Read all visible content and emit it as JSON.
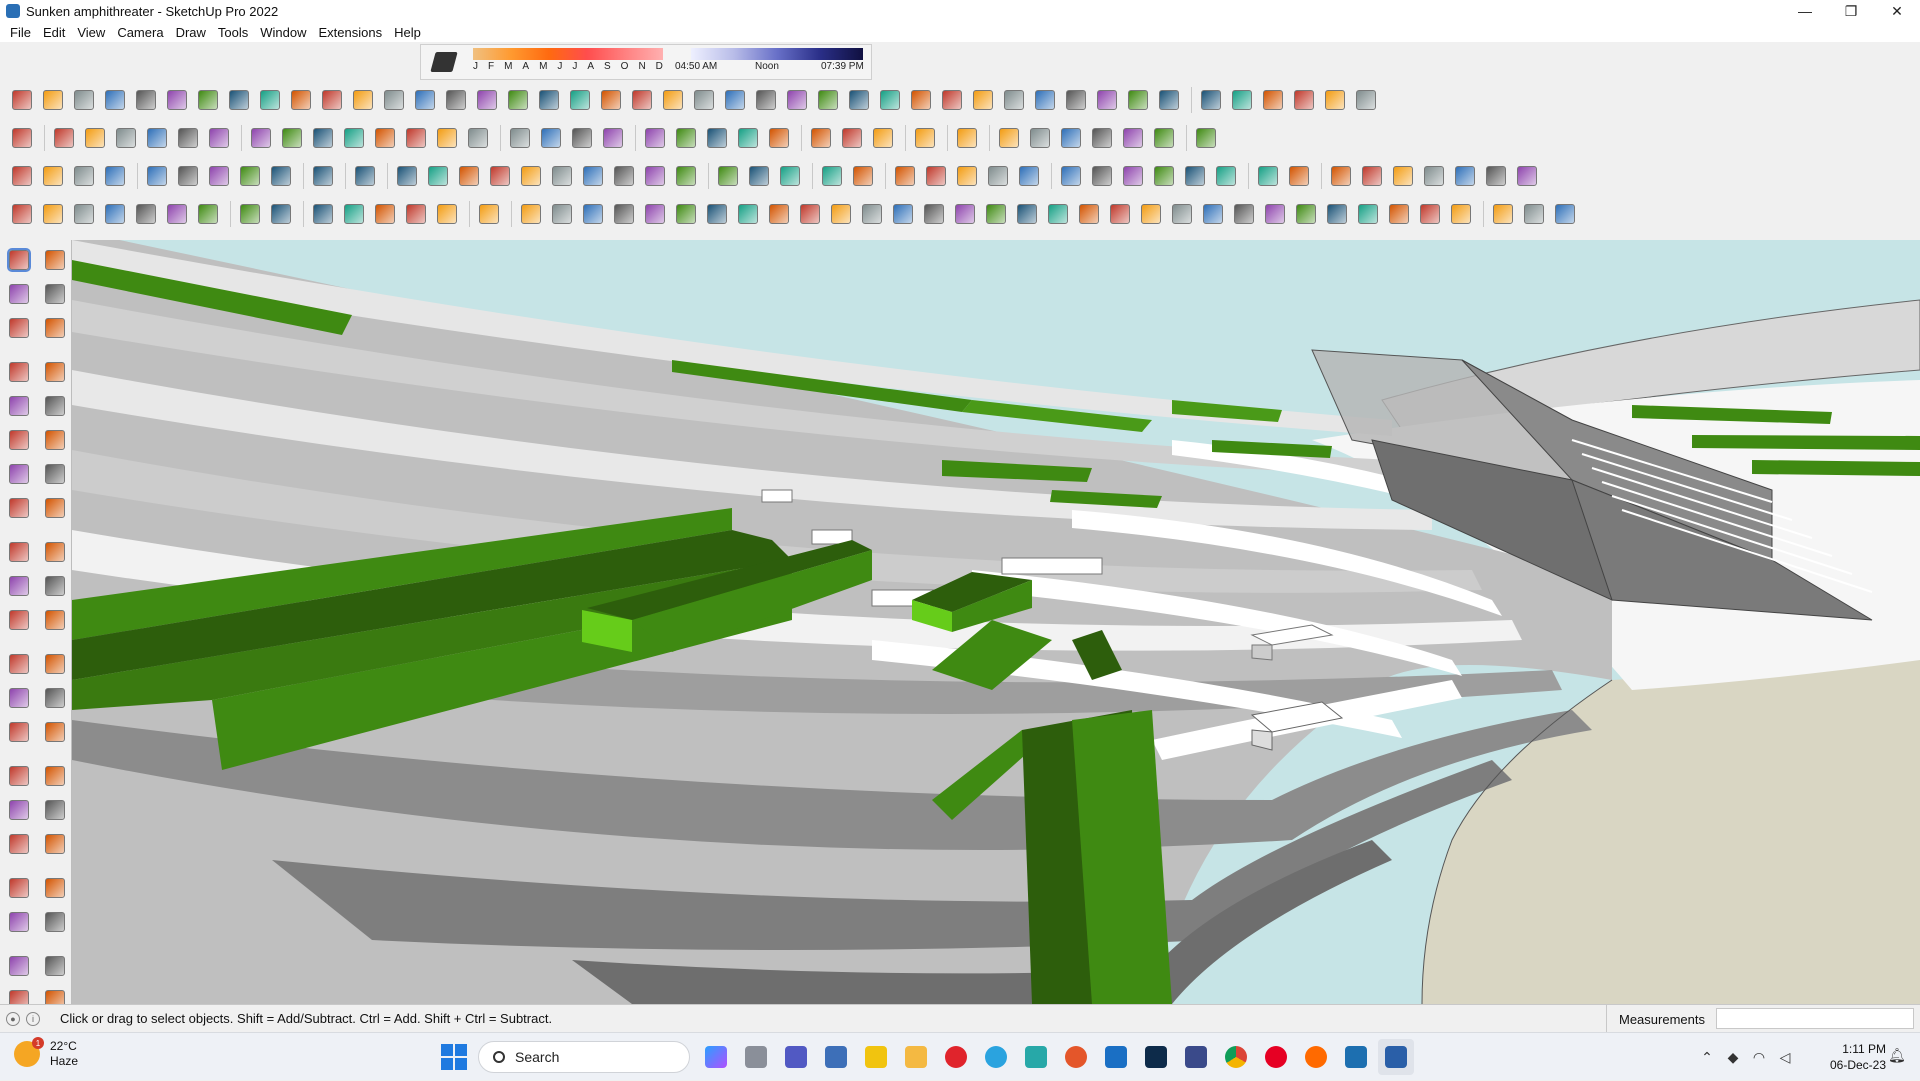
{
  "window": {
    "title": "Sunken amphithreater - SketchUp Pro 2022",
    "controls": [
      "—",
      "❐",
      "✕"
    ]
  },
  "menu": [
    "File",
    "Edit",
    "View",
    "Camera",
    "Draw",
    "Tools",
    "Window",
    "Extensions",
    "Help"
  ],
  "shadows": {
    "months": [
      "J",
      "F",
      "M",
      "A",
      "M",
      "J",
      "J",
      "A",
      "S",
      "O",
      "N",
      "D"
    ],
    "time_start": "04:50 AM",
    "time_mid": "Noon",
    "time_end": "07:39 PM"
  },
  "status": {
    "hint": "Click or drag to select objects. Shift = Add/Subtract. Ctrl = Add. Shift + Ctrl = Subtract.",
    "measurements_label": "Measurements",
    "measurements_value": ""
  },
  "taskbar": {
    "weather_temp": "22°C",
    "weather_desc": "Haze",
    "weather_badge": "1",
    "search_label": "Search",
    "time": "1:11 PM",
    "date": "06-Dec-23"
  },
  "colors": {
    "sky": "#c6e4e6",
    "ground": "#d9d6c3",
    "green": "#3f8a12",
    "green_light": "#66cc1a",
    "green_dark": "#2d5e0c",
    "step_white": "#ffffff",
    "step_gray": "#9a9a9a"
  }
}
